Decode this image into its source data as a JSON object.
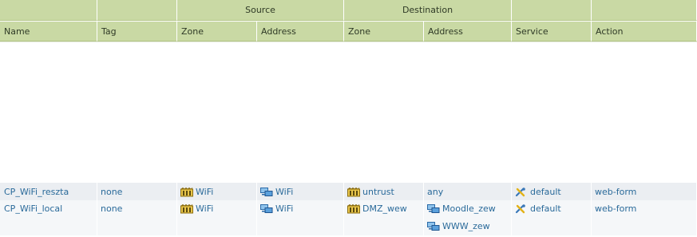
{
  "header": {
    "groups": {
      "source": "Source",
      "destination": "Destination"
    },
    "columns": {
      "name": "Name",
      "tag": "Tag",
      "source_zone": "Zone",
      "source_address": "Address",
      "dest_zone": "Zone",
      "dest_address": "Address",
      "service": "Service",
      "action": "Action"
    }
  },
  "rules": [
    {
      "name": "CP_WiFi_reszta",
      "tag": "none",
      "source_zone": {
        "label": "WiFi",
        "icon": "zone-icon"
      },
      "source_address": {
        "label": "WiFi",
        "icon": "address-object-icon"
      },
      "dest_zone": {
        "label": "untrust",
        "icon": "zone-icon"
      },
      "dest_address": "any",
      "service": {
        "label": "default",
        "icon": "service-tools-icon"
      },
      "action": "web-form"
    },
    {
      "name": "CP_WiFi_local",
      "tag": "none",
      "source_zone": {
        "label": "WiFi",
        "icon": "zone-icon"
      },
      "source_address": {
        "label": "WiFi",
        "icon": "address-object-icon"
      },
      "dest_zone": {
        "label": "DMZ_wew",
        "icon": "zone-icon"
      },
      "dest_address": [
        {
          "label": "Moodle_zew",
          "icon": "address-object-icon"
        },
        {
          "label": "WWW_zew",
          "icon": "address-object-icon"
        }
      ],
      "service": {
        "label": "default",
        "icon": "service-tools-icon"
      },
      "action": "web-form"
    }
  ],
  "colors": {
    "header_bg": "#c9d9a4",
    "link_text": "#2a6a9a",
    "row_bg_1": "#ebeef2",
    "row_bg_2": "#f5f7f9"
  }
}
